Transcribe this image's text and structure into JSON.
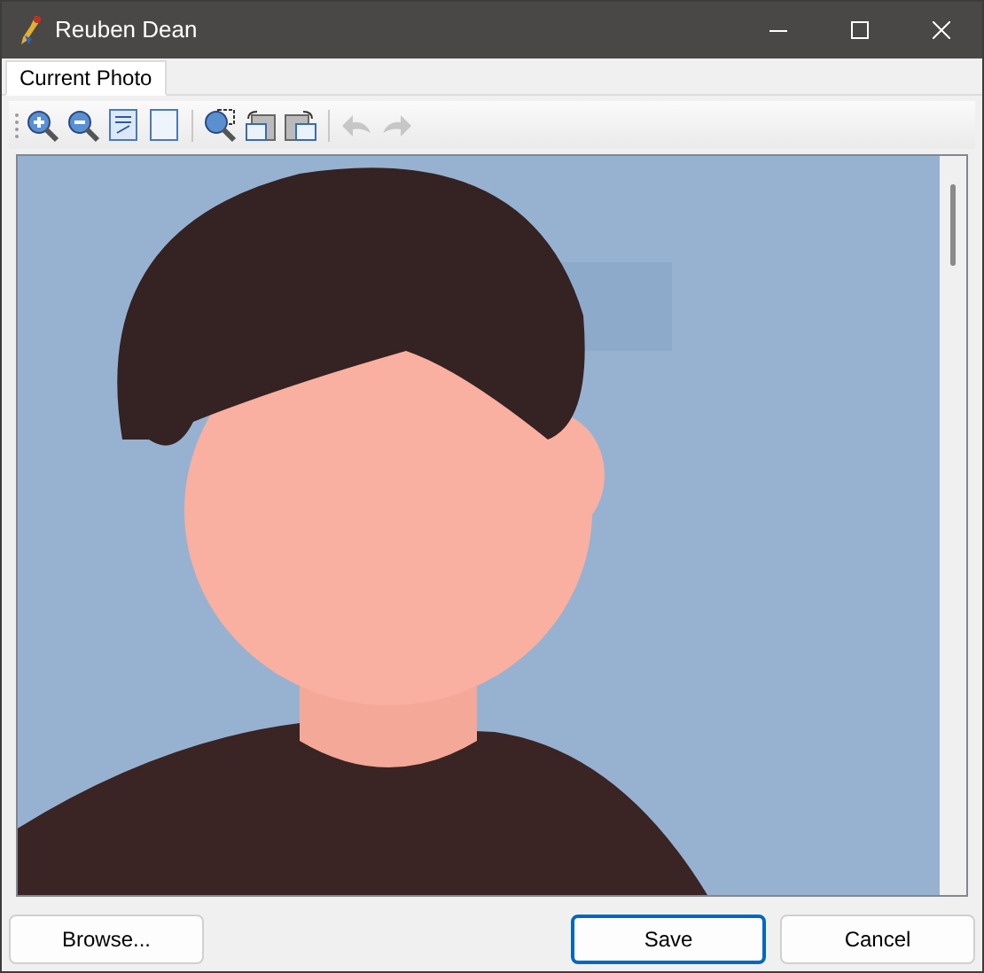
{
  "window": {
    "title": "Reuben Dean"
  },
  "tabs": [
    {
      "label": "Current Photo",
      "selected": true
    }
  ],
  "toolbar": [
    {
      "kind": "zoom_in",
      "disabled": false
    },
    {
      "kind": "zoom_out",
      "disabled": false
    },
    {
      "kind": "actual_size",
      "disabled": false
    },
    {
      "kind": "fit",
      "disabled": false
    },
    {
      "kind": "zoom_selection",
      "disabled": false
    },
    {
      "kind": "rotate_left",
      "disabled": false
    },
    {
      "kind": "rotate_right",
      "disabled": false
    },
    {
      "kind": "undo",
      "disabled": true
    },
    {
      "kind": "redo",
      "disabled": true
    }
  ],
  "buttons": [
    {
      "label": "Browse...",
      "default": false
    },
    {
      "label": "Save",
      "default": true
    },
    {
      "label": "Cancel",
      "default": false
    }
  ]
}
